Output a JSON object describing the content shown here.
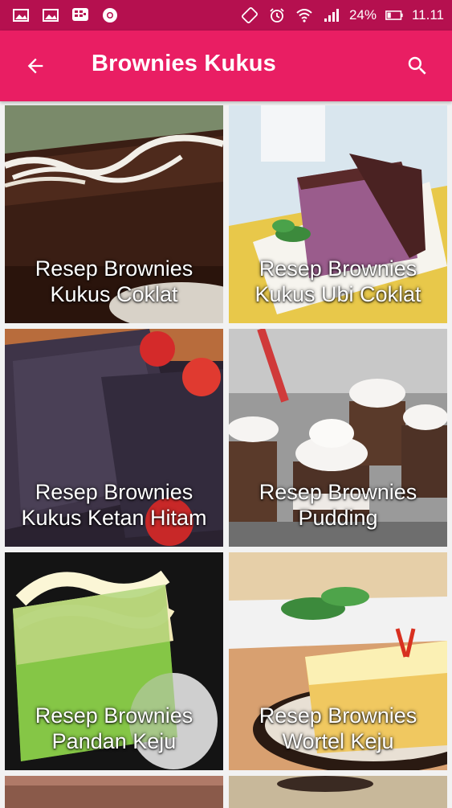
{
  "status_bar": {
    "battery": "24%",
    "time": "11.11",
    "left_icons": [
      "image-icon",
      "image-icon",
      "bbm-icon",
      "chrome-icon"
    ],
    "right_icons": [
      "rotate-icon",
      "alarm-icon",
      "wifi-icon",
      "signal-icon",
      "battery-icon"
    ]
  },
  "app_bar": {
    "title": "Brownies Kukus",
    "back_icon": "arrow-back-icon",
    "search_icon": "search-icon",
    "color": "#e91e63"
  },
  "recipes": [
    {
      "line1": "Resep Brownies",
      "line2": "Kukus Coklat"
    },
    {
      "line1": "Resep Brownies",
      "line2": "Kukus Ubi Coklat"
    },
    {
      "line1": "Resep Brownies",
      "line2": "Kukus Ketan Hitam"
    },
    {
      "line1": "Resep Brownies",
      "line2": "Pudding"
    },
    {
      "line1": "Resep Brownies",
      "line2": "Pandan Keju"
    },
    {
      "line1": "Resep Brownies",
      "line2": "Wortel Keju"
    }
  ]
}
